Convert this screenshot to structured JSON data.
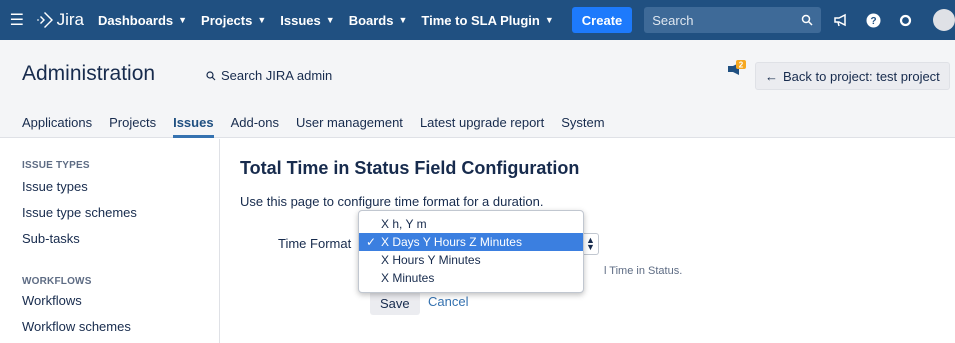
{
  "topnav": {
    "logo": "Jira",
    "items": [
      {
        "label": "Dashboards"
      },
      {
        "label": "Projects"
      },
      {
        "label": "Issues"
      },
      {
        "label": "Boards"
      },
      {
        "label": "Time to SLA Plugin"
      }
    ],
    "create_label": "Create",
    "search_placeholder": "Search"
  },
  "admin": {
    "title": "Administration",
    "search_label": "Search JIRA admin",
    "notification_count": "2",
    "back_label": "Back to project: test project"
  },
  "tabs": [
    {
      "label": "Applications"
    },
    {
      "label": "Projects"
    },
    {
      "label": "Issues",
      "active": true
    },
    {
      "label": "Add-ons"
    },
    {
      "label": "User management"
    },
    {
      "label": "Latest upgrade report"
    },
    {
      "label": "System"
    }
  ],
  "sidebar": {
    "section1": "ISSUE TYPES",
    "items1": [
      "Issue types",
      "Issue type schemes",
      "Sub-tasks"
    ],
    "section2": "WORKFLOWS",
    "items2": [
      "Workflows",
      "Workflow schemes"
    ]
  },
  "main": {
    "title": "Total Time in Status Field Configuration",
    "description": "Use this page to configure time format for a duration.",
    "form_label": "Time Format",
    "help_text": "l Time in Status.",
    "save_label": "Save",
    "cancel_label": "Cancel"
  },
  "dropdown": {
    "options": [
      "X h, Y m",
      "X Days Y Hours Z Minutes",
      "X Hours Y Minutes",
      "X Minutes"
    ],
    "selected_index": 1
  },
  "colors": {
    "nav_bg": "#205081",
    "accent": "#3572b0",
    "selected_option": "#3b7fe0"
  }
}
